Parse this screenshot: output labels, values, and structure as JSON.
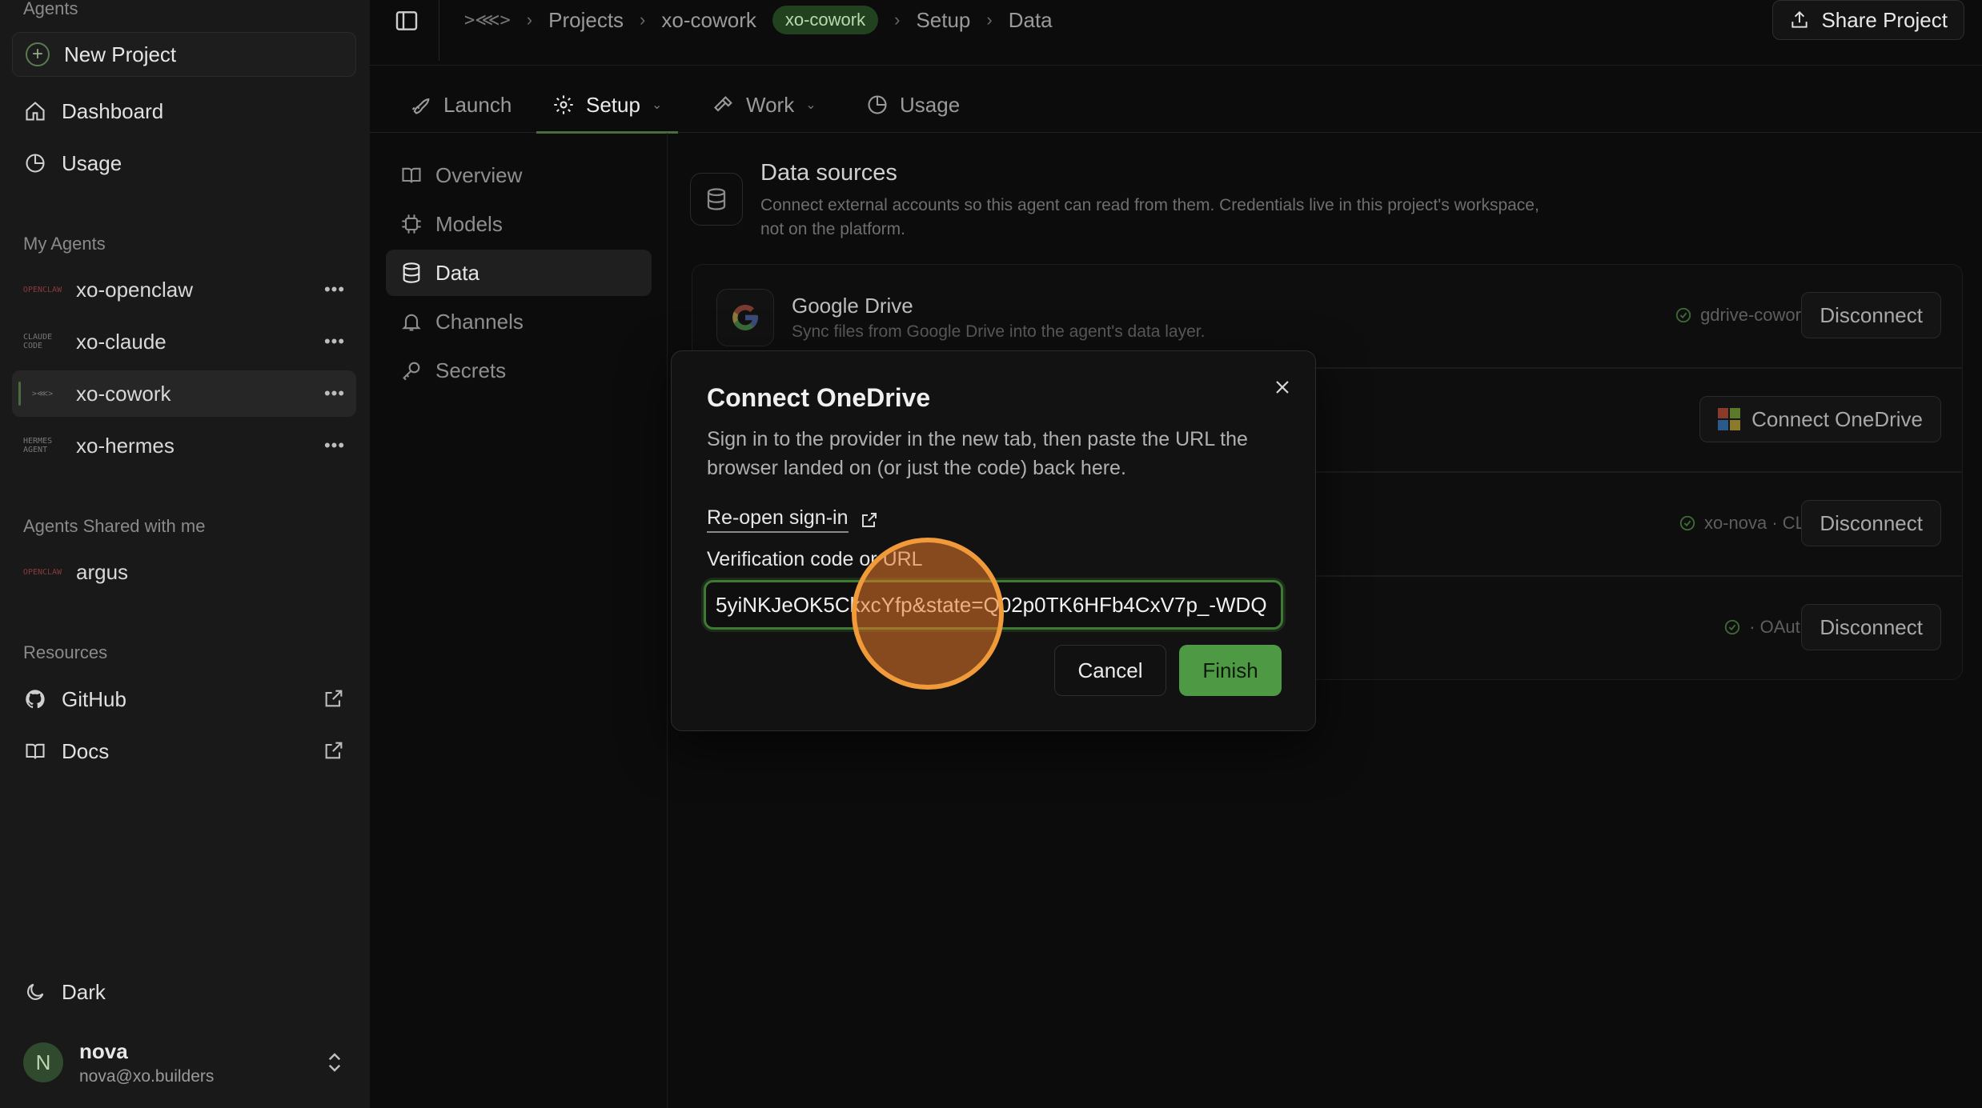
{
  "sidebar": {
    "agents_label": "Agents",
    "new_project": "New Project",
    "nav": {
      "dashboard": "Dashboard",
      "usage": "Usage"
    },
    "my_agents_label": "My Agents",
    "my_agents": [
      {
        "name": "xo-openclaw",
        "logo": "OPENCLAW"
      },
      {
        "name": "xo-claude",
        "logo": "CLAUDE CODE"
      },
      {
        "name": "xo-cowork",
        "logo": ">⋘>"
      },
      {
        "name": "xo-hermes",
        "logo": "HERMES AGENT"
      }
    ],
    "shared_label": "Agents Shared with me",
    "shared_agents": [
      {
        "name": "argus",
        "logo": "OPENCLAW"
      }
    ],
    "resources_label": "Resources",
    "resources": {
      "github": "GitHub",
      "docs": "Docs"
    },
    "theme": "Dark",
    "user": {
      "initial": "N",
      "name": "nova",
      "email": "nova@xo.builders"
    }
  },
  "topbar": {
    "breadcrumbs": {
      "logo": ">⋘>",
      "projects": "Projects",
      "project": "xo-cowork",
      "badge": "xo-cowork",
      "setup": "Setup",
      "data": "Data"
    },
    "share": "Share Project"
  },
  "tabs": {
    "launch": "Launch",
    "setup": "Setup",
    "work": "Work",
    "usage": "Usage"
  },
  "subnav": {
    "overview": "Overview",
    "models": "Models",
    "data": "Data",
    "channels": "Channels",
    "secrets": "Secrets"
  },
  "data_sources": {
    "title": "Data sources",
    "description": "Connect external accounts so this agent can read from them. Credentials live in this project's workspace, not on the platform.",
    "cards": [
      {
        "title": "Google Drive",
        "description": "Sync files from Google Drive into the agent's data layer.",
        "status": "gdrive-cowork",
        "button": "Disconnect"
      },
      {
        "button": "Connect OneDrive"
      },
      {
        "status": "xo-nova · CLI",
        "button": "Disconnect"
      },
      {
        "status": "· OAuth",
        "button": "Disconnect"
      }
    ]
  },
  "modal": {
    "title": "Connect OneDrive",
    "description": "Sign in to the provider in the new tab, then paste the URL the browser landed on (or just the code) back here.",
    "reopen": "Re-open sign-in",
    "field_label": "Verification code or URL",
    "field_value": "5yiNKJeOK5CkxcYfp&state=Q02p0TK6HFb4CxV7p_-WDQ",
    "cancel": "Cancel",
    "finish": "Finish"
  },
  "colors": {
    "accent": "#4e9a44",
    "badge_bg": "#22421f",
    "cursor": "#f09a3a"
  }
}
